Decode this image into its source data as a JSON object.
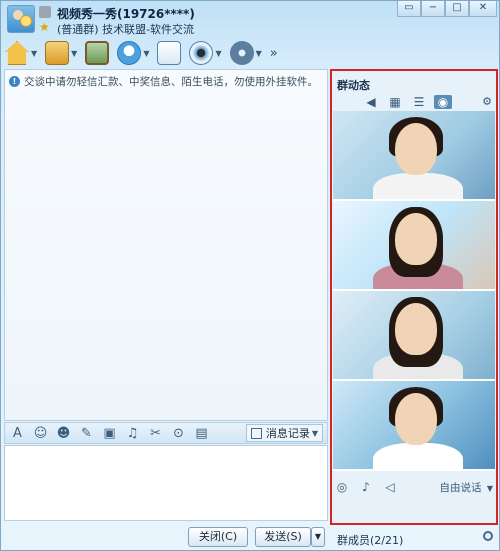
{
  "window": {
    "group_name": "视频秀一秀(19726****)",
    "group_subtitle": "(普通群) 技术联盟-软件交流",
    "controls": [
      "▭",
      "−",
      "□",
      "✕"
    ]
  },
  "toolbar": {
    "items": [
      "home-icon",
      "folder-icon",
      "whiteboard-icon",
      "voice-icon",
      "message-icon",
      "camera-icon",
      "settings-icon"
    ],
    "more_label": "»"
  },
  "chat": {
    "notice": "交谈中请勿轻信汇款、中奖信息、陌生电话，勿使用外挂软件。"
  },
  "input_toolbar": {
    "icons": [
      "font-icon",
      "emoji-icon",
      "magic-icon",
      "doodle-icon",
      "image-icon",
      "music-icon",
      "screenshot-icon",
      "fetion-icon",
      "screen-share-icon"
    ],
    "history_label": "消息记录"
  },
  "footer": {
    "close_label": "关闭(C)",
    "send_label": "发送(S)",
    "member_count": "群成员(2/21)"
  },
  "right_panel": {
    "title": "群动态",
    "tabs": [
      "speaker-icon",
      "picture-icon",
      "list-icon",
      "video-icon"
    ],
    "free_talk": "自由说话",
    "tiles": 4
  }
}
